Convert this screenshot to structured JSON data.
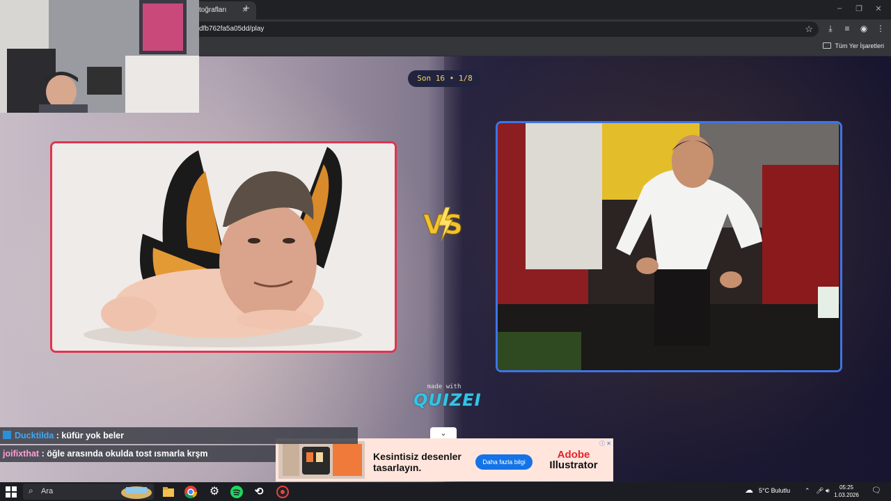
{
  "browser": {
    "tab_title": "toğrafları",
    "tab_close": "×",
    "new_tab": "+",
    "url": "dfb762fa5a05dd/play",
    "bookmarks_label": "Tüm Yer İşaretleri"
  },
  "window_controls": [
    "–",
    "❐",
    "✕"
  ],
  "quiz": {
    "round_badge": "Son 16 • 1/8",
    "made_with": "made with",
    "brand": "QUIZEI",
    "collapse_icon": "⌄",
    "left_frame_color": "#e0344f",
    "right_frame_color": "#3f74e6"
  },
  "ad": {
    "title": "Kesintisiz desenler tasarlayın.",
    "button": "Daha fazla bilgi",
    "brand_line1": "Adobe",
    "brand_line2": "Illustrator",
    "info": "ⓘ ✕"
  },
  "chat": [
    {
      "user": "Ducktilda",
      "message": " : küfür yok beler"
    },
    {
      "user": "joifixthat",
      "message": " : öğle arasında okulda tost ısmarla krşm"
    }
  ],
  "taskbar": {
    "search_label": "Ara",
    "weather": "5°C  Bulutlu",
    "time": "05:25",
    "date": "1.03.2026"
  }
}
